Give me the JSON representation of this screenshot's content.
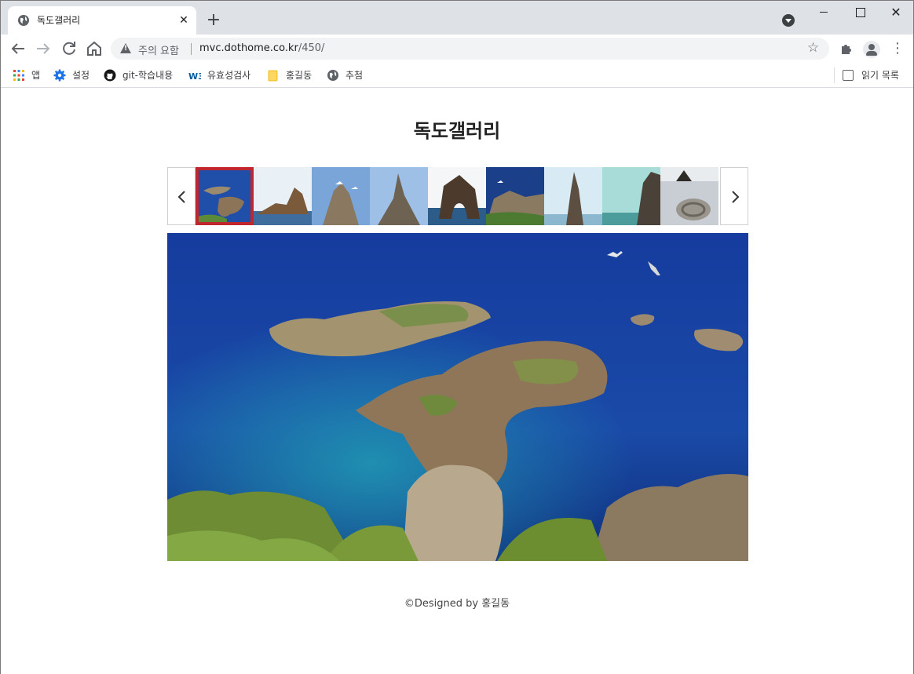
{
  "browser": {
    "tab": {
      "title": "독도갤러리",
      "close": "✕"
    },
    "new_tab": "+",
    "window_close": "✕",
    "omnibox": {
      "security_label": "주의 요함",
      "url_host": "mvc.dothome.co.kr",
      "url_path": "/450/"
    },
    "bookmarks": [
      {
        "label": "앱",
        "icon": "apps-grid-icon"
      },
      {
        "label": "설정",
        "icon": "gear-icon"
      },
      {
        "label": "git-학습내용",
        "icon": "github-icon"
      },
      {
        "label": "유효성검사",
        "icon": "w3c-icon"
      },
      {
        "label": "홍길동",
        "icon": "folder-icon"
      },
      {
        "label": "추첨",
        "icon": "globe-icon"
      }
    ],
    "reading_list": "읽기 목록"
  },
  "page": {
    "title": "독도갤러리",
    "gallery": {
      "selected_index": 0,
      "thumbnails": [
        {
          "icon": "dokdo-aerial-thumbnail"
        },
        {
          "icon": "rock-islet-thumbnail"
        },
        {
          "icon": "seagull-rock-thumbnail"
        },
        {
          "icon": "spire-rock-thumbnail"
        },
        {
          "icon": "arch-rock-thumbnail"
        },
        {
          "icon": "seagull-cliff-thumbnail"
        },
        {
          "icon": "needle-rock-thumbnail"
        },
        {
          "icon": "cliff-coast-thumbnail"
        },
        {
          "icon": "monument-thumbnail"
        }
      ]
    },
    "footer": "©Designed by 홍길동"
  },
  "colors": {
    "accent_border": "#c0262e",
    "sea_deep": "#12389a",
    "sea_shallow": "#1d7fa6"
  }
}
